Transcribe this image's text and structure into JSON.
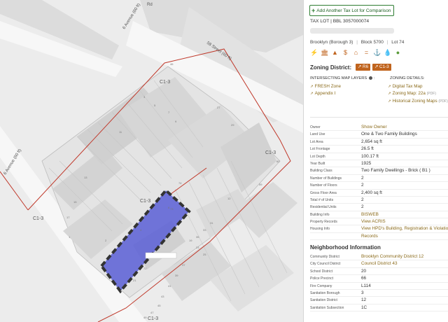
{
  "map": {
    "street_labels": [
      "6 Avenue (60 ft)",
      "58 Street (60 ft)",
      "6 Avenue (60 ft)",
      "Rd"
    ],
    "zone_labels": [
      "C1-3",
      "C1-3",
      "C1-3",
      "C1-3",
      "C1-3"
    ],
    "lot_numbers": [
      "46",
      "3",
      "5",
      "7",
      "9",
      "11",
      "13",
      "15",
      "17",
      "6",
      "4",
      "2",
      "1",
      "74",
      "73",
      "72",
      "21",
      "19",
      "23",
      "25",
      "27",
      "29",
      "60",
      "59",
      "12",
      "31",
      "33",
      "35",
      "37",
      "39",
      "41",
      "43",
      "45",
      "47",
      "49"
    ],
    "highlight_color": "#5a5fd6",
    "zone_line_color": "#c0392b"
  },
  "panel": {
    "close_glyph": "✕",
    "add_button": "Add Another Tax Lot for Comparison",
    "tax_lot": "TAX LOT | BBL 3057000074",
    "borough": "Brooklyn (Borough 3)",
    "block": "Block 5700",
    "lot": "Lot 74",
    "sep": "|",
    "icons": [
      "lightning-icon",
      "bank-icon",
      "road-icon",
      "dollar-icon",
      "house-icon",
      "equals-icon",
      "anchor-icon",
      "drop-icon",
      "pin-icon"
    ],
    "zoning_heading": "Zoning District:",
    "zoning_tags": [
      "R6",
      "C1-3"
    ],
    "intersecting_heading": "INTERSECTING MAP LAYERS",
    "intersecting_items": [
      "FRESH Zone",
      "Appendix I"
    ],
    "zoning_details_heading": "ZONING DETAILS:",
    "zoning_details": [
      "Digital Tax Map",
      "Zoning Map: 22a",
      "Historical Zoning Maps"
    ],
    "pdf_suffix": "(PDF)",
    "lot_rows": [
      {
        "k": "Owner",
        "v": "Show Owner",
        "link": true
      },
      {
        "k": "Land Use",
        "v": "One & Two Family Buildings",
        "link": false
      },
      {
        "k": "Lot Area",
        "v": "2,654 sq ft",
        "link": false
      },
      {
        "k": "Lot Frontage",
        "v": "26.5 ft",
        "link": false
      },
      {
        "k": "Lot Depth",
        "v": "100.17 ft",
        "link": false
      },
      {
        "k": "Year Built",
        "v": "1925",
        "link": false
      },
      {
        "k": "Building Class",
        "v": "Two Family Dwellings - Brick ( B1 )",
        "link": false
      },
      {
        "k": "Number of Buildings",
        "v": "2",
        "link": false
      },
      {
        "k": "Number of Floors",
        "v": "2",
        "link": false
      },
      {
        "k": "Gross Floor Area",
        "v": "2,400 sq ft",
        "link": false
      },
      {
        "k": "Total # of Units",
        "v": "2",
        "link": false
      },
      {
        "k": "Residential Units",
        "v": "2",
        "link": false
      },
      {
        "k": "Building Info",
        "v": "BISWEB",
        "link": true
      },
      {
        "k": "Property Records",
        "v": "View ACRIS",
        "link": true
      },
      {
        "k": "Housing Info",
        "v": "View HPD's Building, Registration & Violations",
        "link": true
      },
      {
        "k": "",
        "v": "Records",
        "link": true
      }
    ],
    "neighborhood_heading": "Neighborhood Information",
    "neighborhood_rows": [
      {
        "k": "Community District",
        "v": "Brooklyn Community District 12",
        "link": true
      },
      {
        "k": "City Council District",
        "v": "Council District 43",
        "link": true
      },
      {
        "k": "School District",
        "v": "20",
        "link": false
      },
      {
        "k": "Police Precinct",
        "v": "66",
        "link": false
      },
      {
        "k": "Fire Company",
        "v": "L114",
        "link": false
      },
      {
        "k": "Sanitation Borough",
        "v": "3",
        "link": false
      },
      {
        "k": "Sanitation District",
        "v": "12",
        "link": false
      },
      {
        "k": "Sanitation Subsection",
        "v": "1C",
        "link": false
      }
    ]
  }
}
